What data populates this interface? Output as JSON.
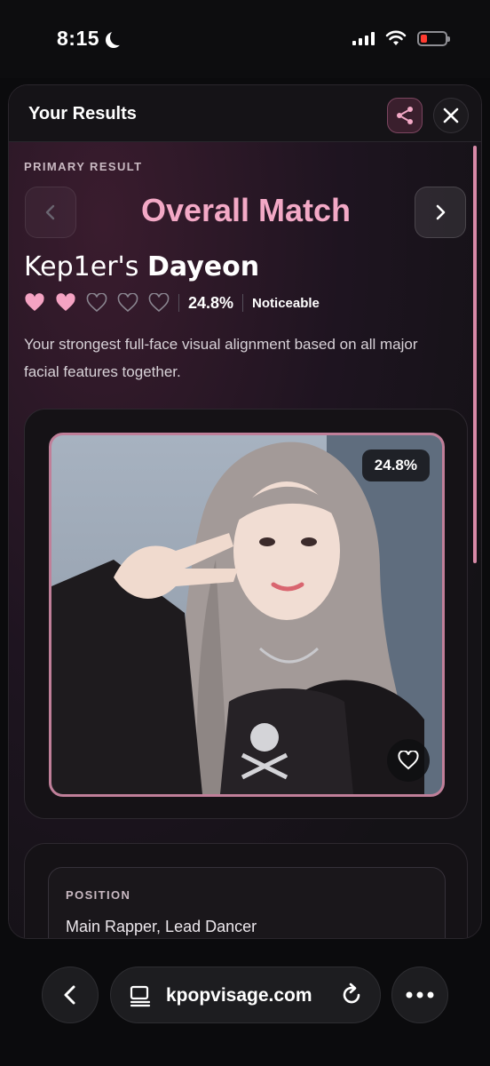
{
  "status_bar": {
    "time": "8:15",
    "battery_color": "#ff3b30"
  },
  "modal": {
    "title": "Your Results",
    "share_icon": "share-icon",
    "close_icon": "close-icon"
  },
  "result": {
    "label": "PRIMARY RESULT",
    "section_title": "Overall Match",
    "group": "Kep1er's",
    "idol": "Dayeon",
    "hearts_filled": 2,
    "hearts_total": 5,
    "percent": "24.8%",
    "level": "Noticeable",
    "description": "Your strongest full-face visual alignment based on all major facial features together.",
    "photo_percent": "24.8%"
  },
  "info": {
    "label": "POSITION",
    "value": "Main Rapper, Lead Dancer"
  },
  "browser": {
    "url": "kpopvisage.com"
  },
  "colors": {
    "accent": "#f3a9c6",
    "heart": "#f5a3c3",
    "frame": "#c07f99"
  }
}
